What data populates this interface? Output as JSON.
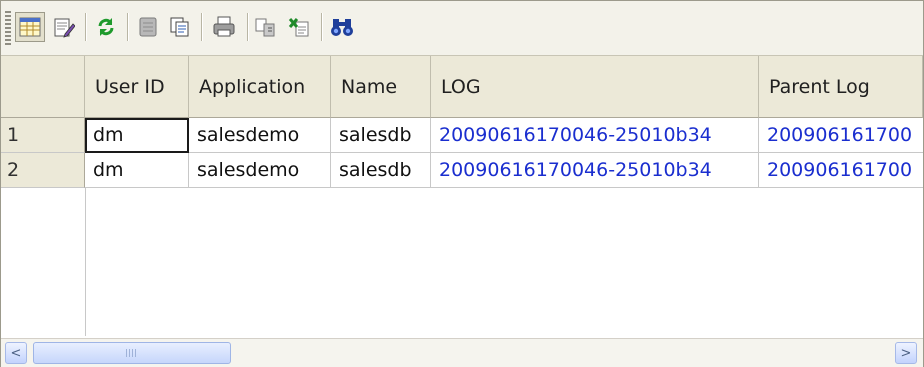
{
  "toolbar": {
    "buttons": [
      {
        "name": "grid-view",
        "icon": "table-icon"
      },
      {
        "name": "edit-form",
        "icon": "notepad-pencil-icon"
      },
      {
        "name": "refresh",
        "icon": "refresh-icon"
      },
      {
        "name": "memo",
        "icon": "note-icon"
      },
      {
        "name": "copy",
        "icon": "copy-icon"
      },
      {
        "name": "print",
        "icon": "printer-icon"
      },
      {
        "name": "export",
        "icon": "export-icon"
      },
      {
        "name": "excel",
        "icon": "excel-icon"
      },
      {
        "name": "find",
        "icon": "binoculars-icon"
      }
    ]
  },
  "grid": {
    "columns": [
      "User ID",
      "Application",
      "Name",
      "LOG",
      "Parent Log"
    ],
    "rows": [
      {
        "num": "1",
        "user_id": "dm",
        "application": "salesdemo",
        "name": "salesdb",
        "log": "20090616170046-25010b34",
        "parent_log": "200906161700"
      },
      {
        "num": "2",
        "user_id": "dm",
        "application": "salesdemo",
        "name": "salesdb",
        "log": "20090616170046-25010b34",
        "parent_log": "200906161700"
      }
    ]
  },
  "scrollbar": {
    "left_arrow": "<",
    "right_arrow": ">"
  },
  "colors": {
    "link": "#1a2ecf",
    "header_bg": "#ece9d8",
    "scroll_thumb": "#c6d6fb"
  }
}
